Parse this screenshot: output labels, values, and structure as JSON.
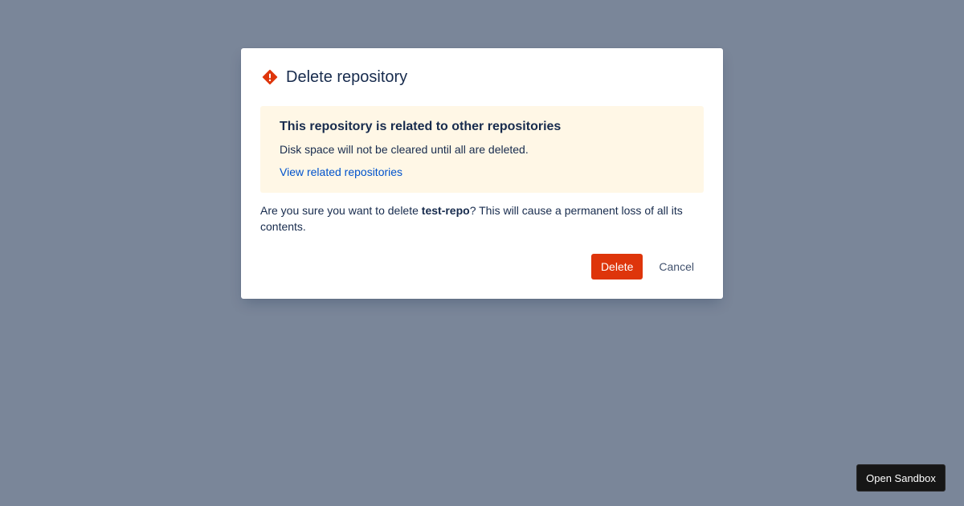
{
  "colors": {
    "backdrop": "#7a8699",
    "modal_bg": "#ffffff",
    "warning_bg": "#fff7e6",
    "danger": "#de350b",
    "link": "#0052cc",
    "text": "#172b4d",
    "sandbox_bg": "#161616"
  },
  "modal": {
    "icon": "warning-icon",
    "title": "Delete repository",
    "section_message": {
      "title": "This repository is related to other repositories",
      "body": "Disk space will not be cleared until all are deleted.",
      "link_label": "View related repositories"
    },
    "confirm": {
      "prefix": "Are you sure you want to delete ",
      "repo_name": "test-repo",
      "suffix": "? This will cause a permanent loss of all its contents."
    },
    "actions": {
      "delete_label": "Delete",
      "cancel_label": "Cancel"
    }
  },
  "sandbox": {
    "label": "Open Sandbox"
  }
}
